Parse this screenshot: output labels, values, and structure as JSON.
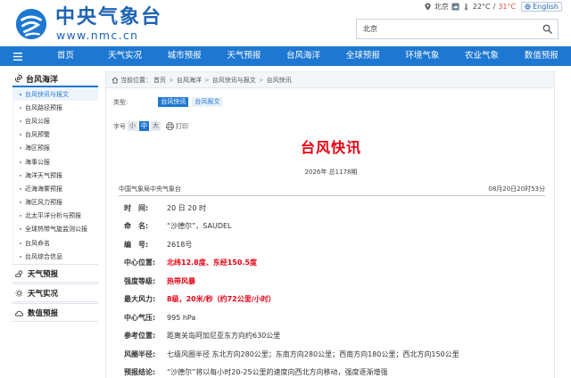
{
  "header": {
    "site_title": "中央气象台",
    "site_url": "www.nmc.cn",
    "city": "北京",
    "temp_low": "22°C",
    "temp_sep": "/",
    "temp_high": "31°C",
    "lang_label": "English",
    "search_value": "北京"
  },
  "nav": {
    "items": [
      "首页",
      "天气实况",
      "城市预报",
      "天气预报",
      "台风海洋",
      "全球预报",
      "环境气象",
      "农业气象",
      "数值预报"
    ]
  },
  "sidebar": {
    "section_title": "台风海洋",
    "items": [
      "台风快讯与报文",
      "台风路径预报",
      "台风公报",
      "台风预警",
      "海区预报",
      "海事公报",
      "海洋天气预报",
      "近海海雾预报",
      "海区风力预报",
      "北太平洋分析与预报",
      "全球热带气旋监测公报",
      "台风命名",
      "台风综合信息"
    ],
    "sections": [
      "天气预报",
      "天气实况",
      "数值预报"
    ]
  },
  "breadcrumb": {
    "prefix": "当前位置：",
    "items": [
      "首页",
      "台风海洋",
      "台风快讯与报文",
      "台风快讯"
    ]
  },
  "type_row": {
    "label": "类型:",
    "tags": [
      "台风快讯",
      "台风报文"
    ]
  },
  "font_row": {
    "label": "字号",
    "sizes": [
      "小",
      "中",
      "大"
    ],
    "print_label": "打印"
  },
  "article": {
    "title": "台风快讯",
    "issue": "2026年 总1178期",
    "source": "中国气象局中央气象台",
    "datetime": "08月20日20时53分",
    "fields": [
      {
        "label": "时　间:",
        "value": "20 日 20 时",
        "highlight": false
      },
      {
        "label": "命　名:",
        "value": "“沙德尔”，SAUDEL",
        "highlight": false
      },
      {
        "label": "编　号:",
        "value": "2618号",
        "highlight": false
      },
      {
        "label": "中心位置:",
        "value": "北纬12.8度、东经150.5度",
        "highlight": true
      },
      {
        "label": "强度等级:",
        "value": "热带风暴",
        "highlight": true
      },
      {
        "label": "最大风力:",
        "value": "8级，20米/秒（约72公里/小时）",
        "highlight": true
      },
      {
        "label": "中心气压:",
        "value": "995 hPa",
        "highlight": false
      },
      {
        "label": "参考位置:",
        "value": "距离关岛阿加尼亚东方向约630公里",
        "highlight": false
      },
      {
        "label": "风圈半径:",
        "value": "七级风圈半径 东北方向280公里；东南方向280公里；西南方向180公里；西北方向150公里",
        "highlight": false
      },
      {
        "label": "预报结论:",
        "value": "“沙德尔”将以每小时20-25公里的速度向西北方向移动，强度逐渐增强",
        "highlight": false
      }
    ]
  }
}
